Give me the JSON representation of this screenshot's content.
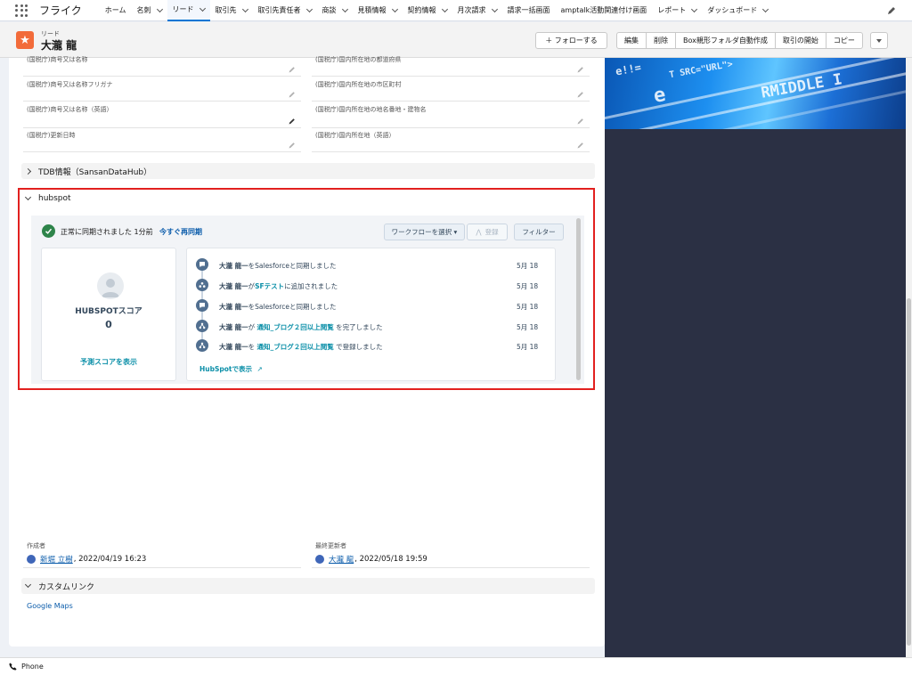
{
  "nav": {
    "app_name": "フライク",
    "items": [
      {
        "label": "ホーム",
        "dropdown": false,
        "active": false
      },
      {
        "label": "名刺",
        "dropdown": true,
        "active": false
      },
      {
        "label": "リード",
        "dropdown": true,
        "active": true
      },
      {
        "label": "取引先",
        "dropdown": true,
        "active": false
      },
      {
        "label": "取引先責任者",
        "dropdown": true,
        "active": false
      },
      {
        "label": "商談",
        "dropdown": true,
        "active": false
      },
      {
        "label": "見積情報",
        "dropdown": true,
        "active": false
      },
      {
        "label": "契約情報",
        "dropdown": true,
        "active": false
      },
      {
        "label": "月次請求",
        "dropdown": true,
        "active": false
      },
      {
        "label": "請求一括画面",
        "dropdown": false,
        "active": false
      },
      {
        "label": "amptalk活動関連付け画面",
        "dropdown": false,
        "active": false
      },
      {
        "label": "レポート",
        "dropdown": true,
        "active": false
      },
      {
        "label": "ダッシュボード",
        "dropdown": true,
        "active": false
      }
    ]
  },
  "record": {
    "type": "リード",
    "name": "大瀧 龍",
    "follow_label": "＋ フォローする",
    "actions": [
      "編集",
      "削除",
      "Box親形フォルダ自動作成",
      "取引の開始",
      "コピー"
    ]
  },
  "fields": {
    "left": [
      "(国税庁)商号又は名称",
      "(国税庁)商号又は名称フリガナ",
      "(国税庁)商号又は名称（英語）",
      "(国税庁)更新日時"
    ],
    "right": [
      "(国税庁)国内所在地の都道府県",
      "(国税庁)国内所在地の市区町村",
      "(国税庁)国内所在地の地名番地・建物名",
      "(国税庁)国内所在地（英語）"
    ]
  },
  "sections": {
    "tdb": "TDB情報（SansanDataHub）",
    "hubspot": "hubspot",
    "custom_links": "カスタムリンク"
  },
  "hubspot": {
    "sync_status": "正常に同期されました 1分前",
    "resync_link": "今すぐ再同期",
    "workflow_button": "ワークフローを選択 ▾",
    "register_button": "登録",
    "filter_button": "フィルター",
    "score_label": "HUBSPOTスコア",
    "score_value": "0",
    "predict_link": "予測スコアを表示",
    "view_link": "HubSpotで表示",
    "activities": [
      {
        "name": "大瀧 龍一",
        "mid": "をSalesforceと同期しました",
        "link": "",
        "tail": "",
        "date": "5月 18",
        "icon": "chat"
      },
      {
        "name": "大瀧 龍一",
        "mid": "が",
        "link": "SFテスト",
        "tail": "に追加されました",
        "date": "5月 18",
        "icon": "list"
      },
      {
        "name": "大瀧 龍一",
        "mid": "をSalesforceと同期しました",
        "link": "",
        "tail": "",
        "date": "5月 18",
        "icon": "chat"
      },
      {
        "name": "大瀧 龍一",
        "mid": "が ",
        "link": "通知_ブログ２回以上閲覧",
        "tail": " を完了しました",
        "date": "5月 18",
        "icon": "flow"
      },
      {
        "name": "大瀧 龍一",
        "mid": "を ",
        "link": "通知_ブログ２回以上閲覧",
        "tail": " で登録しました",
        "date": "5月 18",
        "icon": "flow"
      }
    ]
  },
  "system": {
    "created_label": "作成者",
    "created_user": "新堀 立樹",
    "created_date": ", 2022/04/19 16:23",
    "modified_label": "最終更新者",
    "modified_user": "大瀧 龍",
    "modified_date": ", 2022/05/18 19:59"
  },
  "custom_links": {
    "google_maps": "Google Maps"
  },
  "footer": {
    "phone": "Phone"
  },
  "colors": {
    "brand_blue": "#0176d3",
    "record_icon": "#f26b3a",
    "highlight_red": "#e2201f",
    "hubspot_teal": "#0b8fa8",
    "success_green": "#2e844a"
  }
}
